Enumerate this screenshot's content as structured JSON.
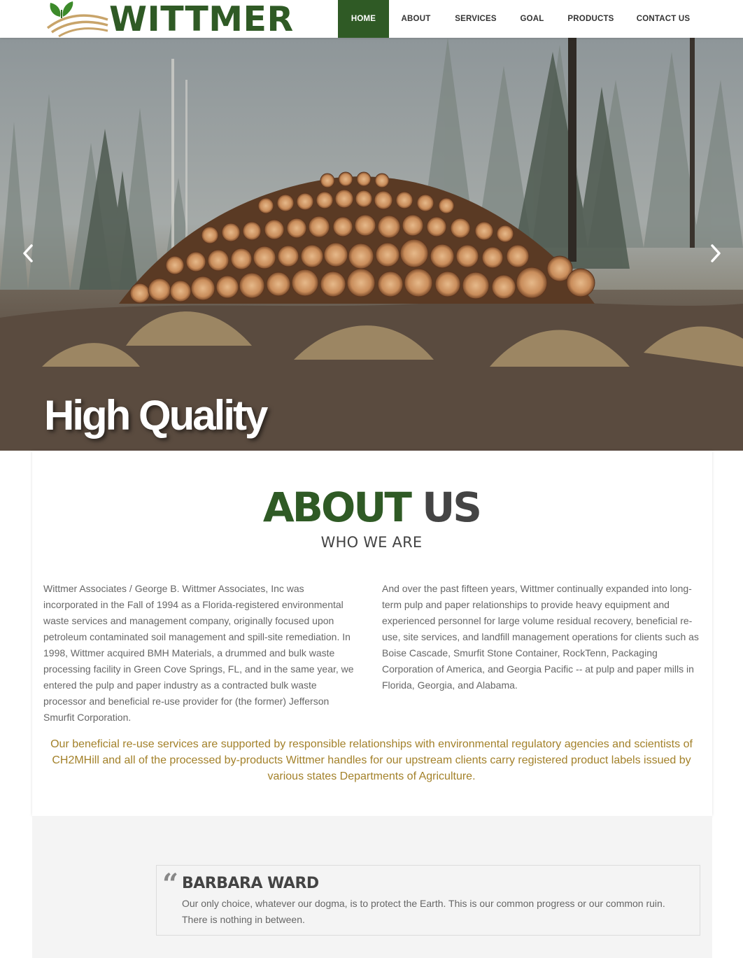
{
  "brand": {
    "name": "WITTMER",
    "primary_color": "#2f5a25",
    "accent_color": "#a3812a"
  },
  "nav": {
    "items": [
      {
        "label": "HOME",
        "active": true
      },
      {
        "label": "ABOUT",
        "active": false
      },
      {
        "label": "SERVICES",
        "active": false
      },
      {
        "label": "GOAL",
        "active": false
      },
      {
        "label": "PRODUCTS",
        "active": false
      },
      {
        "label": "CONTACT US",
        "active": false
      }
    ]
  },
  "hero": {
    "caption": "High Quality",
    "prev_icon": "chevron-left-icon",
    "next_icon": "chevron-right-icon"
  },
  "about": {
    "title_green": "ABOUT",
    "title_dark": "US",
    "subtitle": "WHO WE ARE",
    "col_left": "Wittmer Associates / George B. Wittmer Associates, Inc was incorporated in the Fall of 1994 as a Florida-registered environmental waste services and management company, originally focused upon petroleum contaminated soil management and spill-site remediation. In 1998, Wittmer acquired BMH Materials, a drummed and bulk waste processing facility in Green Cove Springs, FL, and in the same year, we entered the pulp and paper industry as a contracted bulk waste processor and beneficial re-use provider for (the former) Jefferson Smurfit Corporation.",
    "col_right": "And over the past fifteen years, Wittmer continually expanded into long-term pulp and paper relationships to provide heavy equipment and experienced personnel for large volume residual recovery, beneficial re-use, site services, and landfill management operations for clients such as Boise Cascade, Smurfit Stone Container, RockTenn, Packaging Corporation of America, and Georgia Pacific -- at pulp and paper mills in Florida, Georgia, and Alabama.",
    "highlight": "Our beneficial re-use services are supported by responsible relationships with environmental regulatory agencies and scientists of CH2MHill and all of the processed by-products Wittmer handles for our upstream clients carry registered product labels issued by various states Departments of Agriculture."
  },
  "testimonial": {
    "quote_mark": "“",
    "name": "BARBARA WARD",
    "text": "Our only choice, whatever our dogma, is to protect the Earth. This is our common progress or our common ruin. There is nothing in between."
  }
}
